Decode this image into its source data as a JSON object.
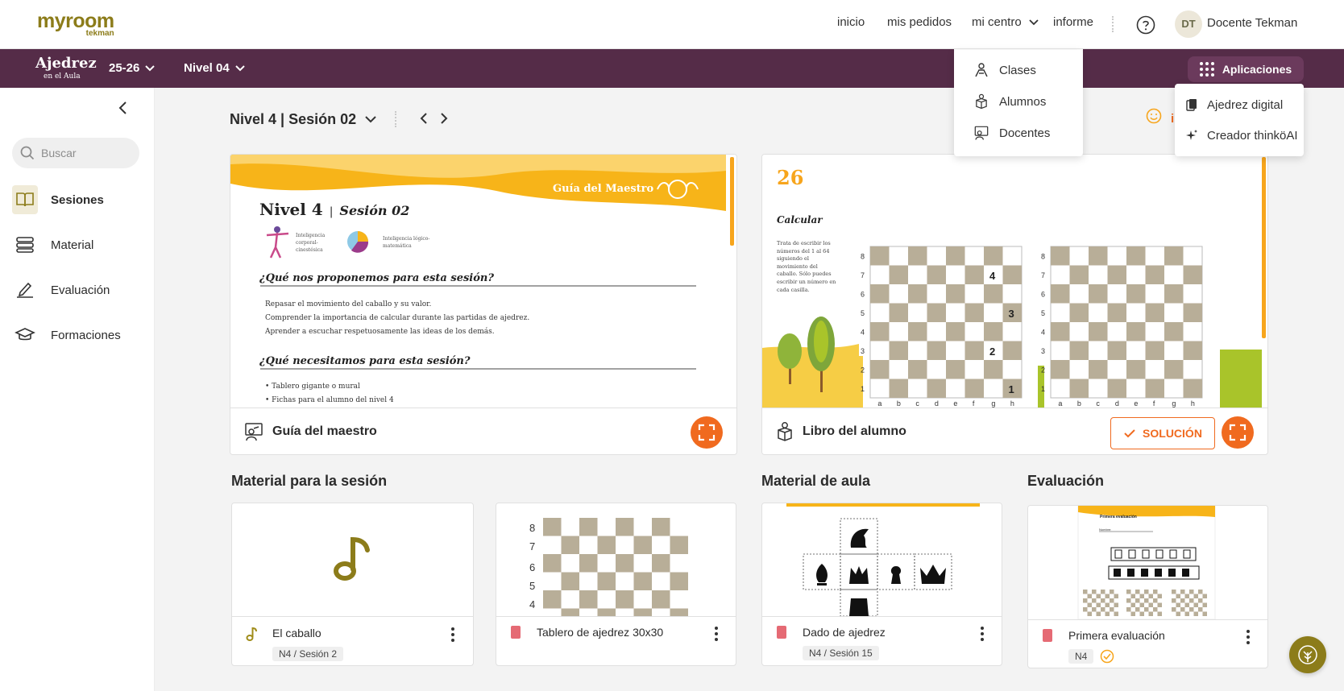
{
  "topbar": {
    "logo_main": "myroom",
    "logo_sub": "tekman",
    "nav": [
      "inicio",
      "mis pedidos",
      "mi centro",
      "informe"
    ],
    "user_initials": "DT",
    "user_name": "Docente Tekman"
  },
  "appbar": {
    "logo_main": "Ajedrez",
    "logo_sub": "en el Aula",
    "year": "25-26",
    "level": "Nivel 04",
    "apps_label": "Aplicaciones"
  },
  "mi_centro_menu": [
    "Clases",
    "Alumnos",
    "Docentes"
  ],
  "apps_menu": [
    "Ajedrez digital",
    "Creador thinköAI"
  ],
  "sidebar": {
    "search_placeholder": "Buscar",
    "items": [
      {
        "label": "Sesiones",
        "icon": "book-icon",
        "active": true
      },
      {
        "label": "Material",
        "icon": "stack-icon",
        "active": false
      },
      {
        "label": "Evaluación",
        "icon": "pen-icon",
        "active": false
      },
      {
        "label": "Formaciones",
        "icon": "graduation-cap-icon",
        "active": false
      }
    ]
  },
  "session": {
    "title": "Nivel 4 | Sesión 02",
    "partial_label": "i"
  },
  "guide_card": {
    "label": "Guía del maestro",
    "doc_header": "Guía del Maestro",
    "doc_title_a": "Nivel 4",
    "doc_title_b": "Sesión 02",
    "intel1": "Inteligencia corporal-cinestésica",
    "intel2": "Inteligencia lógico-matemática",
    "q1": "¿Qué nos proponemos para esta sesión?",
    "q1_lines": [
      "Repasar el movimiento del caballo y su valor.",
      "Comprender la importancia de calcular durante las partidas de ajedrez.",
      "Aprender a escuchar respetuosamente las ideas de los demás."
    ],
    "q2": "¿Qué necesitamos para esta sesión?",
    "q2_lines": [
      "• Tablero gigante o mural",
      "• Fichas para el alumno del nivel 4"
    ]
  },
  "student_card": {
    "label": "Libro del alumno",
    "page_number": "26",
    "heading": "Calcular",
    "instructions": "Trata de escribir los números del 1 al 64 siguiendo el movimiento del caballo. Sólo puedes escribir un número en cada casilla.",
    "solution_label": "SOLUCIÓN",
    "board_numbers": [
      "4",
      "3",
      "2",
      "1"
    ],
    "ranks": [
      "8",
      "7",
      "6",
      "5",
      "4",
      "3",
      "2",
      "1"
    ],
    "files": [
      "a",
      "b",
      "c",
      "d",
      "e",
      "f",
      "g",
      "h"
    ]
  },
  "sections": {
    "material_sesion": "Material para la sesión",
    "material_aula": "Material de aula",
    "evaluacion": "Evaluación"
  },
  "materials": [
    {
      "title": "El caballo",
      "tag": "N4 / Sesión 2",
      "icon": "music-note-icon"
    },
    {
      "title": "Tablero de ajedrez 30x30",
      "tag": "",
      "icon": "pdf-icon"
    },
    {
      "title": "Dado de ajedrez",
      "tag": "N4 / Sesión 15",
      "icon": "pdf-icon"
    },
    {
      "title": "Primera evaluación",
      "tag": "N4",
      "icon": "pdf-icon"
    }
  ],
  "board_thumb_ranks": [
    "8",
    "7",
    "6",
    "5",
    "4"
  ],
  "eval_thumb_title": "Primera evaluación",
  "eval_thumb_name": "Nombre:",
  "colors": {
    "purple": "#552c48",
    "orange": "#f06a1f",
    "olive": "#8c7c1a",
    "yellow": "#f7b419"
  }
}
